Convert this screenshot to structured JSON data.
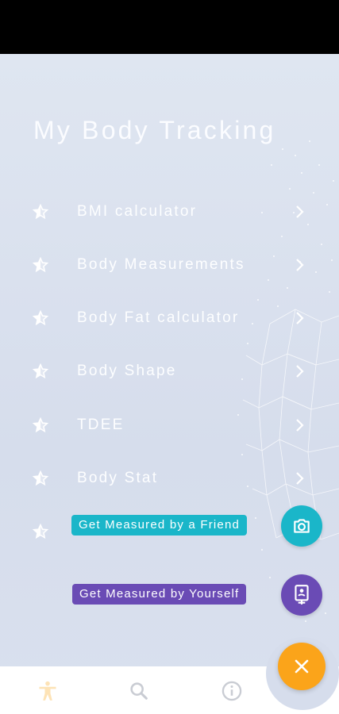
{
  "app": {
    "title": "My Body Tracking"
  },
  "menu": {
    "items": [
      {
        "label": "BMI calculator",
        "icon": "star-icon"
      },
      {
        "label": "Body Measurements",
        "icon": "star-icon"
      },
      {
        "label": "Body Fat calculator",
        "icon": "star-icon"
      },
      {
        "label": "Body Shape",
        "icon": "star-icon"
      },
      {
        "label": "TDEE",
        "icon": "star-icon"
      },
      {
        "label": "Body Stat",
        "icon": "star-icon"
      }
    ]
  },
  "fab_menu": {
    "friend": {
      "label": "Get Measured by a Friend",
      "icon": "camera-icon",
      "color": "#1ab6c9"
    },
    "yourself": {
      "label": "Get Measured by Yourself",
      "icon": "id-badge-icon",
      "color": "#6a4bb5"
    },
    "main": {
      "icon": "close-icon",
      "color": "#fba41a"
    }
  },
  "bottom_nav": {
    "items": [
      {
        "name": "body",
        "icon": "person-icon",
        "active": true
      },
      {
        "name": "search",
        "icon": "search-icon",
        "active": false
      },
      {
        "name": "info",
        "icon": "info-icon",
        "active": false
      }
    ],
    "active_color": "#fde3b6",
    "inactive_color": "#c9ccd3"
  }
}
